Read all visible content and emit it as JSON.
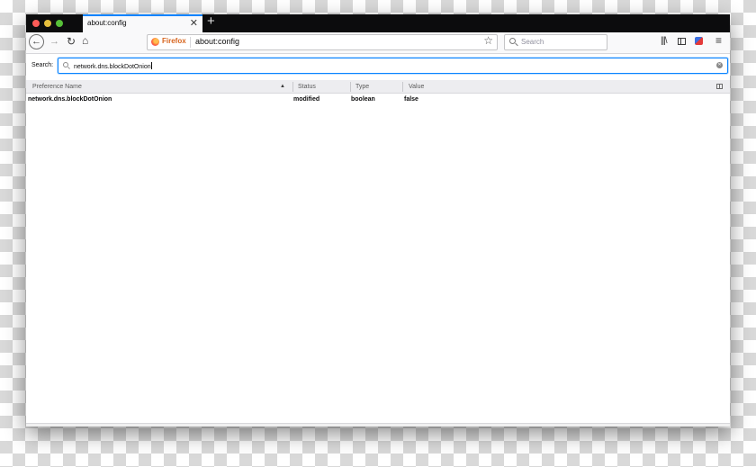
{
  "tabbar": {
    "tab_title": "about:config",
    "close_glyph": "✕",
    "new_tab_glyph": "+"
  },
  "toolbar": {
    "back_glyph": "←",
    "forward_glyph": "→",
    "reload_glyph": "↻",
    "home_glyph": "⌂",
    "identity_label": "Firefox",
    "url": "about:config",
    "bookmark_glyph": "☆",
    "search_placeholder": "Search",
    "library_glyph": "|||\\",
    "menu_glyph": "≡"
  },
  "filter": {
    "label": "Search:",
    "value": "network.dns.blockDotOnion",
    "clear_glyph": "✕"
  },
  "table": {
    "columns": [
      "Preference Name",
      "Status",
      "Type",
      "Value"
    ],
    "sort_glyph": "▲",
    "rows": [
      {
        "name": "network.dns.blockDotOnion",
        "status": "modified",
        "type": "boolean",
        "value": "false"
      }
    ]
  },
  "icons": {
    "back": "back-arrow-icon",
    "forward": "forward-arrow-icon",
    "reload": "reload-icon",
    "home": "home-icon",
    "bookmark": "star-icon",
    "search": "magnifier-icon",
    "library": "library-icon",
    "sidebar": "sidebar-icon",
    "extension": "extension-icon",
    "menu": "hamburger-menu-icon",
    "column_picker": "column-picker-icon"
  },
  "colors": {
    "accent": "#0a84ff",
    "tabbar_bg": "#0c0c0d",
    "toolbar_bg": "#f9f9fa",
    "firefox_label": "#d7641d"
  }
}
